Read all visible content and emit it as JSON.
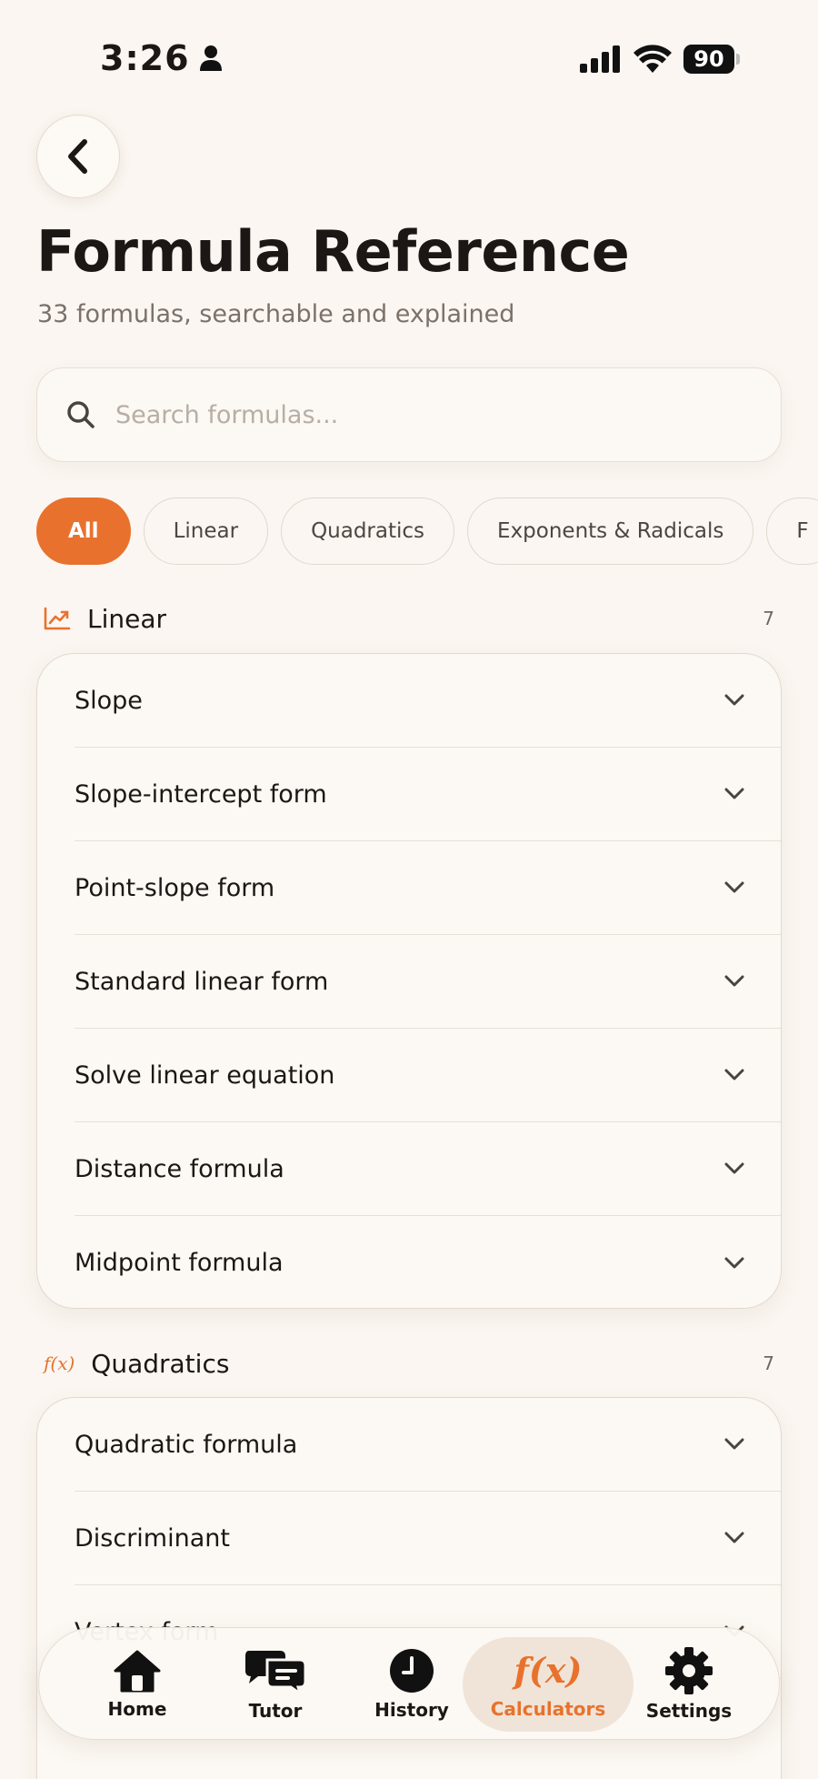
{
  "status_bar": {
    "time": "3:26",
    "battery": "90"
  },
  "header": {
    "title": "Formula Reference",
    "subtitle": "33 formulas, searchable and explained"
  },
  "search": {
    "placeholder": "Search formulas..."
  },
  "filters": [
    {
      "label": "All",
      "active": true
    },
    {
      "label": "Linear",
      "active": false
    },
    {
      "label": "Quadratics",
      "active": false
    },
    {
      "label": "Exponents & Radicals",
      "active": false
    },
    {
      "label": "F",
      "active": false
    }
  ],
  "sections": [
    {
      "title": "Linear",
      "count": "7",
      "icon": "trending-up-icon",
      "items": [
        "Slope",
        "Slope-intercept form",
        "Point-slope form",
        "Standard linear form",
        "Solve linear equation",
        "Distance formula",
        "Midpoint formula"
      ]
    },
    {
      "title": "Quadratics",
      "count": "7",
      "icon_text": "f(x)",
      "items": [
        "Quadratic formula",
        "Discriminant",
        "Vertex form"
      ]
    }
  ],
  "nav": [
    {
      "label": "Home",
      "icon": "home-icon"
    },
    {
      "label": "Tutor",
      "icon": "chat-icon"
    },
    {
      "label": "History",
      "icon": "clock-icon"
    },
    {
      "label": "Calculators",
      "icon_text": "f(x)",
      "active": true
    },
    {
      "label": "Settings",
      "icon": "gear-icon"
    }
  ],
  "colors": {
    "accent": "#e8722d",
    "background": "#fbf6f1",
    "text": "#1c1714"
  }
}
